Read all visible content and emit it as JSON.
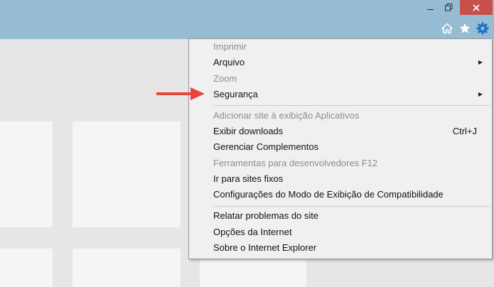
{
  "window": {
    "minimize_icon": "minimize-icon",
    "maximize_icon": "restore-icon",
    "close_icon": "close-icon",
    "toolbar_icons": [
      "home-icon",
      "star-icon",
      "gear-icon"
    ],
    "colors": {
      "titlebar": "#96bcd3",
      "close": "#c7504b",
      "gear": "#1a73c8"
    }
  },
  "menu": {
    "items": [
      {
        "label": "Imprimir",
        "disabled": true
      },
      {
        "label": "Arquivo",
        "submenu": true
      },
      {
        "label": "Zoom",
        "disabled": true
      },
      {
        "label": "Segurança",
        "submenu": true
      },
      {
        "label": "Adicionar site à exibição Aplicativos",
        "disabled": true
      },
      {
        "label": "Exibir downloads",
        "shortcut": "Ctrl+J"
      },
      {
        "label": "Gerenciar Complementos"
      },
      {
        "label": "Ferramentas para desenvolvedores F12",
        "disabled": true
      },
      {
        "label": "Ir para sites fixos"
      },
      {
        "label": "Configurações do Modo de Exibição de Compatibilidade"
      },
      {
        "label": "Relatar problemas do site"
      },
      {
        "label": "Opções da Internet"
      },
      {
        "label": "Sobre o Internet Explorer"
      }
    ]
  },
  "annotation": {
    "arrow_color": "#e8443a"
  }
}
